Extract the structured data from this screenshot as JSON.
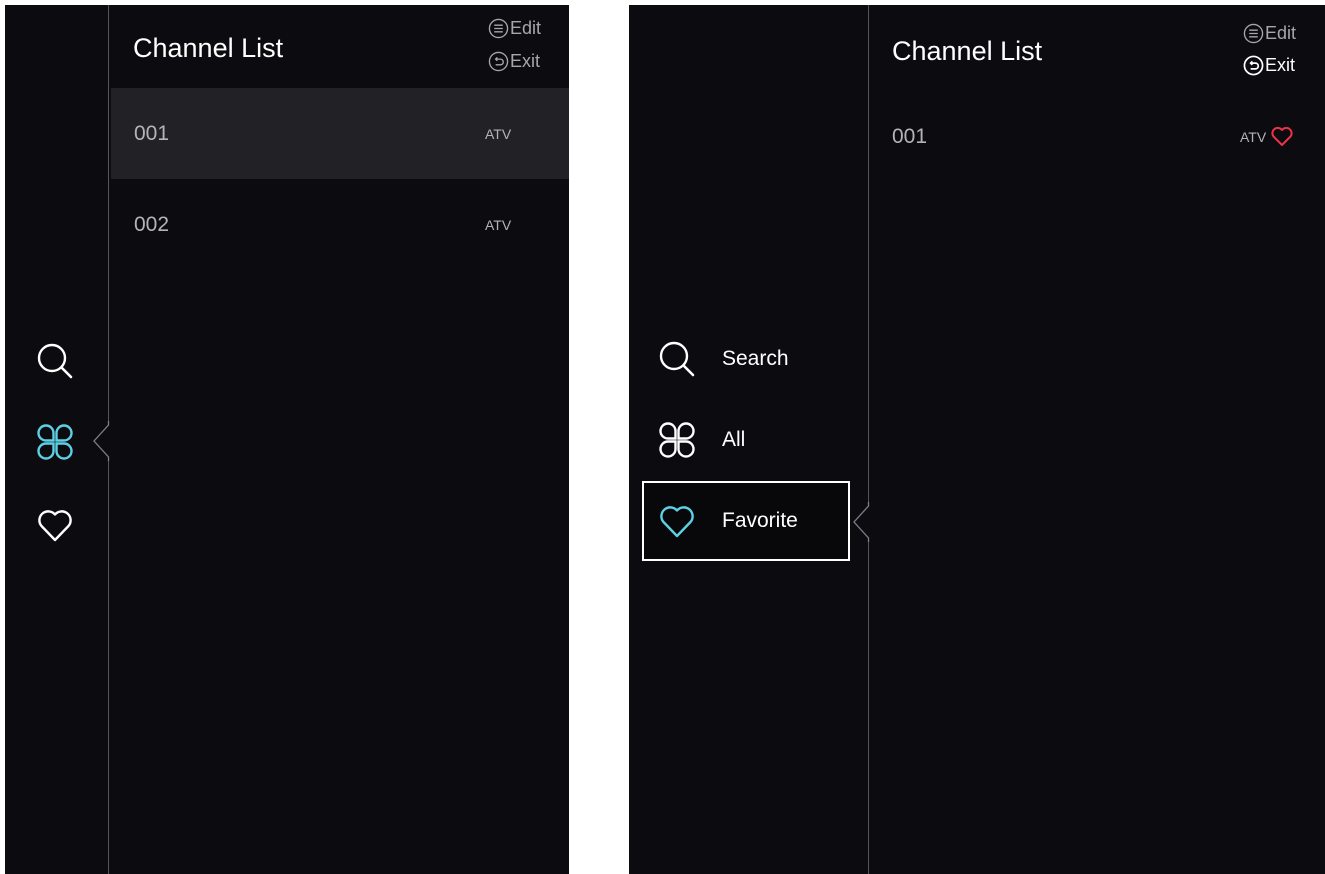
{
  "colors": {
    "background": "#0c0c10",
    "focus_row": "#222226",
    "accent_cyan": "#5ed0e6",
    "favorite_red": "#e8334a",
    "divider": "#55565c"
  },
  "left_view": {
    "title": "Channel List",
    "hints": [
      {
        "icon": "menu-icon",
        "label": "Edit"
      },
      {
        "icon": "back-icon",
        "label": "Exit"
      }
    ],
    "channels": [
      {
        "number": "001",
        "source": "ATV",
        "focused": true
      },
      {
        "number": "002",
        "source": "ATV",
        "focused": false
      }
    ],
    "sidebar": {
      "items": [
        {
          "icon": "search-icon",
          "active": false
        },
        {
          "icon": "all-icon",
          "active": true
        },
        {
          "icon": "heart-icon",
          "active": false
        }
      ]
    }
  },
  "right_view": {
    "title": "Channel List",
    "hints": [
      {
        "icon": "menu-icon",
        "label": "Edit"
      },
      {
        "icon": "back-icon",
        "label": "Exit"
      }
    ],
    "channels": [
      {
        "number": "001",
        "source": "ATV",
        "favorite": true
      }
    ],
    "menu": {
      "items": [
        {
          "icon": "search-icon",
          "label": "Search",
          "selected": false
        },
        {
          "icon": "all-icon",
          "label": "All",
          "selected": false
        },
        {
          "icon": "heart-icon",
          "label": "Favorite",
          "selected": true
        }
      ]
    }
  }
}
